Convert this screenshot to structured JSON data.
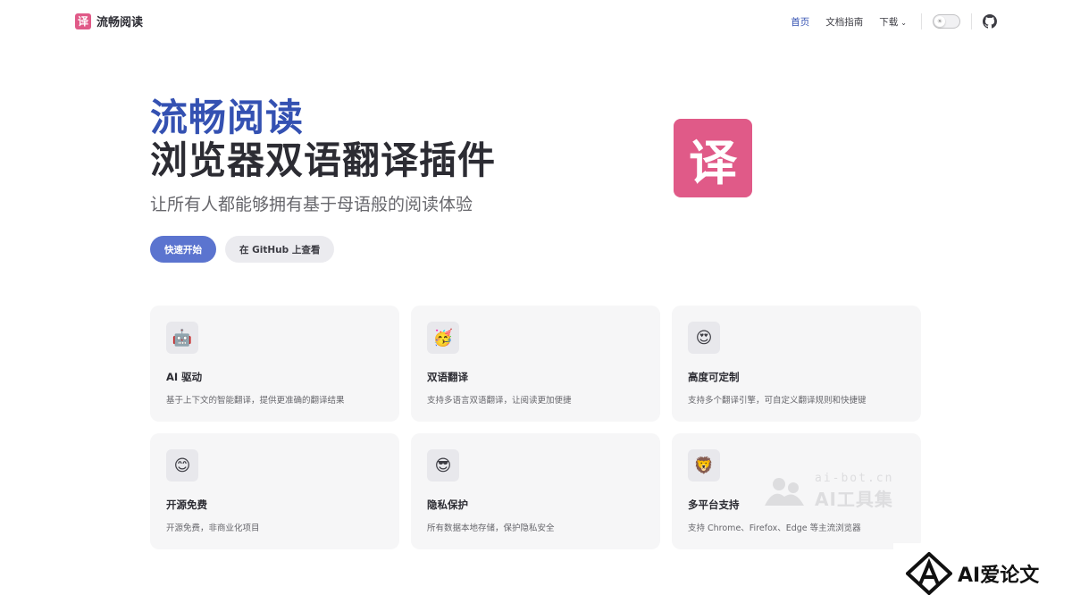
{
  "nav": {
    "brand_logo_char": "译",
    "brand_name": "流畅阅读",
    "links": [
      {
        "label": "首页",
        "active": true
      },
      {
        "label": "文档指南",
        "active": false
      },
      {
        "label": "下载",
        "active": false
      }
    ],
    "theme_toggle_icon": "sun-icon",
    "github_icon": "github-icon"
  },
  "hero": {
    "name": "流畅阅读",
    "text": "浏览器双语翻译插件",
    "tagline": "让所有人都能够拥有基于母语般的阅读体验",
    "primary_action": "快速开始",
    "alt_action": "在 GitHub 上查看",
    "logo_char": "译"
  },
  "features": [
    {
      "icon": "🤖",
      "icon_name": "robot-icon",
      "title": "AI 驱动",
      "details": "基于上下文的智能翻译，提供更准确的翻译结果"
    },
    {
      "icon": "🥳",
      "icon_name": "party-face-icon",
      "title": "双语翻译",
      "details": "支持多语言双语翻译，让阅读更加便捷"
    },
    {
      "icon": "😍",
      "icon_name": "heart-eyes-icon",
      "title": "高度可定制",
      "details": "支持多个翻译引擎，可自定义翻译规则和快捷键"
    },
    {
      "icon": "😊",
      "icon_name": "smile-icon",
      "title": "开源免费",
      "details": "开源免费，非商业化项目"
    },
    {
      "icon": "😎",
      "icon_name": "sunglasses-icon",
      "title": "隐私保护",
      "details": "所有数据本地存储，保护隐私安全"
    },
    {
      "icon": "🦁",
      "icon_name": "lion-icon",
      "title": "多平台支持",
      "details": "支持 Chrome、Firefox、Edge 等主流浏览器"
    }
  ],
  "watermarks": {
    "aibot_url": "ai-bot.cn",
    "aibot_name": "AI工具集",
    "ailunwen_name": "AI爱论文"
  },
  "colors": {
    "brand": "#3451b2",
    "logo_pink": "#e05a88",
    "primary_button": "#5b74cf"
  }
}
